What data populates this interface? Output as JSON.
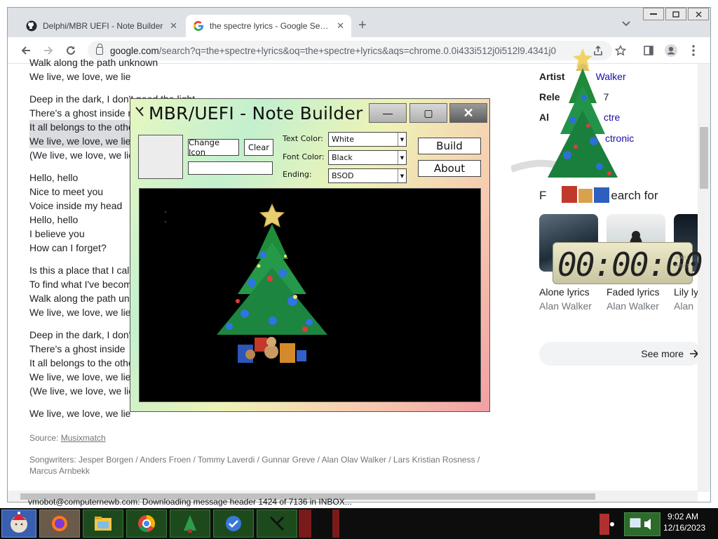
{
  "browser": {
    "tabs": [
      {
        "title": "Delphi/MBR UEFI - Note Builder",
        "close": "✕"
      },
      {
        "title": "the spectre lyrics - Google Search",
        "close": "✕"
      }
    ],
    "new_tab": "+",
    "tab_list": "⌄",
    "url_domain": "google.com",
    "url_rest": "/search?q=the+spectre+lyrics&oq=the+spectre+lyrics&aqs=chrome.0.0i433i512j0i512l9.4341j0"
  },
  "lyrics": {
    "lines_top": [
      "Walk along the path unknown",
      "We live, we love, we lie"
    ],
    "stanza2": [
      "Deep in the dark, I don't need the light",
      "There's a ghost inside me",
      "It all belongs to the other side",
      "We live, we love, we lie",
      "(We live, we love, we lie)"
    ],
    "stanza3": [
      "Hello, hello",
      "Nice to meet you",
      "Voice inside my head",
      "Hello, hello",
      "I believe you",
      "How can I forget?"
    ],
    "stanza4": [
      "Is this a place that I call",
      "To find what I've become",
      "Walk along the path un",
      "We live, we love, we lie"
    ],
    "stanza5": [
      "Deep in the dark, I don't",
      "There's a ghost inside",
      "It all belongs to the other",
      "We live, we love, we lie",
      "(We live, we love, we lie)"
    ],
    "last": "We live, we love, we lie",
    "source_label": "Source:",
    "source_link": "Musixmatch",
    "songwriters": "Songwriters: Jesper Borgen / Anders Froen / Tommy Laverdi / Gunnar Greve / Alan Olav Walker / Lars Kristian Rosness / Marcus Arnbekk"
  },
  "knowledge_panel": {
    "artist_label": "Artist",
    "artist_value": "Walker",
    "released_label": "Rele",
    "released_value": "7",
    "album_label": "Al",
    "album_value": "ctre",
    "genre_value": "ctronic",
    "people_search_fragment": "earch for",
    "thumbs": [
      {
        "title": "Alone lyrics",
        "artist": "Alan Walker"
      },
      {
        "title": "Faded lyrics",
        "artist": "Alan Walker"
      },
      {
        "title": "Lily ly",
        "artist": "Alan"
      }
    ],
    "see_more": "See more"
  },
  "app": {
    "title": "MBR/UEFI - Note Builder",
    "change_icon": "Change Icon",
    "clear": "Clear",
    "text_color_label": "Text Color:",
    "text_color_value": "White",
    "font_color_label": "Font Color:",
    "font_color_value": "Black",
    "ending_label": "Ending:",
    "ending_value": "BSOD",
    "build": "Build",
    "about": "About",
    "minimize": "—",
    "maximize": "▢",
    "close": "✕"
  },
  "timer": {
    "digits": "00:00:00",
    "side_labels": [
      "START",
      "RESET"
    ]
  },
  "taskbar": {
    "time": "9:02 AM",
    "date": "12/16/2023",
    "notification": "vmobot@computernewb.com: Downloading message header 1424 of 7136 in INBOX..."
  },
  "colors": {
    "tab_bar": "#dee1e6",
    "link": "#1a0dab",
    "app_gradient_start": "#e7f7c0",
    "app_gradient_end": "#f29fa3",
    "taskbar": "#0d0d0d"
  }
}
